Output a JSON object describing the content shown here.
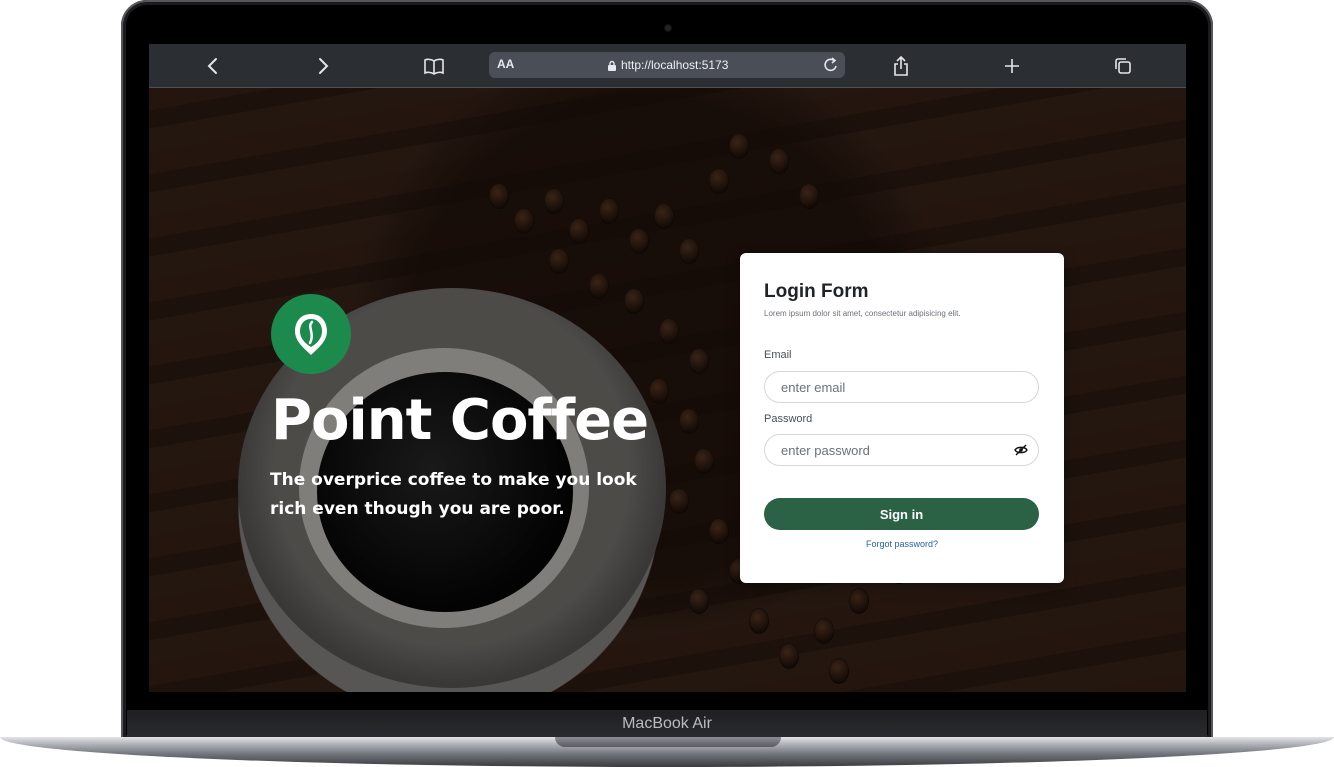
{
  "device": {
    "label": "MacBook Air"
  },
  "browser": {
    "text_size_label": "AA",
    "url": "http://localhost:5173",
    "icons": [
      "chevron-left-icon",
      "chevron-right-icon",
      "book-icon",
      "lock-icon",
      "reload-icon",
      "share-icon",
      "plus-icon",
      "tabs-icon"
    ]
  },
  "hero": {
    "brand_name": "Point Coffee",
    "tagline": "The overprice coffee to make you look rich even though you are poor."
  },
  "login": {
    "title": "Login Form",
    "subtitle": "Lorem ipsum dolor sit amet, consectetur adipisicing elit.",
    "email_label": "Email",
    "email_placeholder": "enter email",
    "password_label": "Password",
    "password_placeholder": "enter password",
    "signin_label": "Sign in",
    "forgot_label": "Forgot password?"
  },
  "colors": {
    "brand_green": "#1b8a4c",
    "button_green": "#2b6144",
    "link_blue": "#2563a8"
  }
}
